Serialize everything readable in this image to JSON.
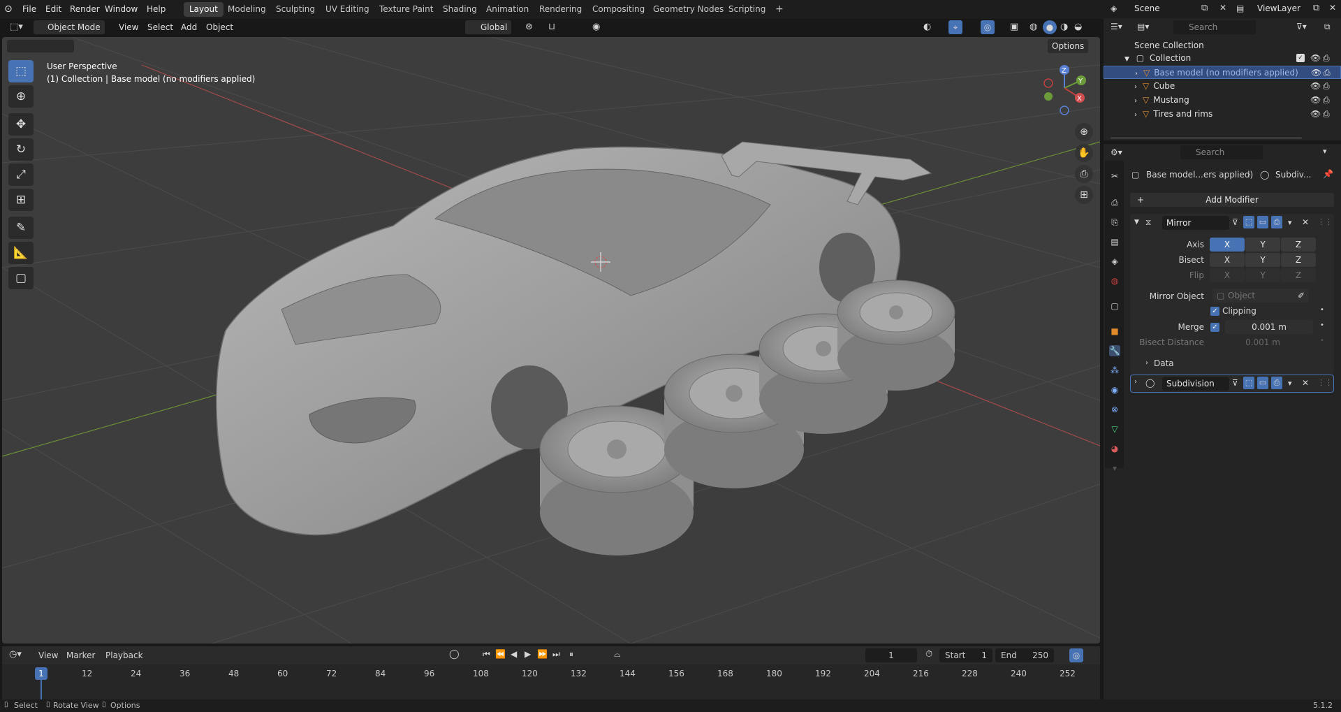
{
  "menu": [
    "File",
    "Edit",
    "Render",
    "Window",
    "Help"
  ],
  "workspaces": [
    "Layout",
    "Modeling",
    "Sculpting",
    "UV Editing",
    "Texture Paint",
    "Shading",
    "Animation",
    "Rendering",
    "Compositing",
    "Geometry Nodes",
    "Scripting"
  ],
  "add_workspace": "+",
  "scene": {
    "name": "Scene",
    "view_layer": "ViewLayer"
  },
  "viewport_header": {
    "mode": "Object Mode",
    "view": "View",
    "select": "Select",
    "add": "Add",
    "object": "Object",
    "orientation": "Global",
    "options": "Options"
  },
  "viewport_overlay": {
    "perspective": "User Perspective",
    "collection_info": "(1) Collection | Base model (no modifiers applied)"
  },
  "gizmo": {
    "x": "X",
    "y": "Y",
    "z": "Z"
  },
  "outliner": {
    "search_placeholder": "Search",
    "scene_collection": "Scene Collection",
    "collection": "Collection",
    "items": [
      {
        "name": "Base model (no modifiers applied)",
        "selected": true
      },
      {
        "name": "Cube",
        "selected": false
      },
      {
        "name": "Mustang",
        "selected": false
      },
      {
        "name": "Tires and rims",
        "selected": false
      }
    ]
  },
  "properties": {
    "search_placeholder": "Search",
    "breadcrumb_object": "Base model...ers applied)",
    "breadcrumb_modifier": "Subdiv...",
    "add_modifier": "Add Modifier",
    "mirror": {
      "name": "Mirror",
      "axis_label": "Axis",
      "bisect_label": "Bisect",
      "flip_label": "Flip",
      "axes": [
        "X",
        "Y",
        "Z"
      ],
      "mirror_object_label": "Mirror Object",
      "mirror_object_placeholder": "Object",
      "clipping_label": "Clipping",
      "merge_label": "Merge",
      "merge_value": "0.001 m",
      "bisect_distance_label": "Bisect Distance",
      "bisect_distance_value": "0.001 m",
      "data_label": "Data"
    },
    "subdivision": {
      "name": "Subdivision"
    }
  },
  "timeline": {
    "view": "View",
    "marker": "Marker",
    "playback": "Playback",
    "current_frame": "1",
    "start_label": "Start",
    "start": "1",
    "end_label": "End",
    "end": "250",
    "ticks": [
      "12",
      "24",
      "36",
      "48",
      "60",
      "72",
      "84",
      "96",
      "108",
      "120",
      "132",
      "144",
      "156",
      "168",
      "180",
      "192",
      "204",
      "216",
      "228",
      "240",
      "252"
    ],
    "playhead": "1"
  },
  "status": {
    "select": "Select",
    "rotate": "Rotate View",
    "options": "Options",
    "version": "5.1.2"
  }
}
